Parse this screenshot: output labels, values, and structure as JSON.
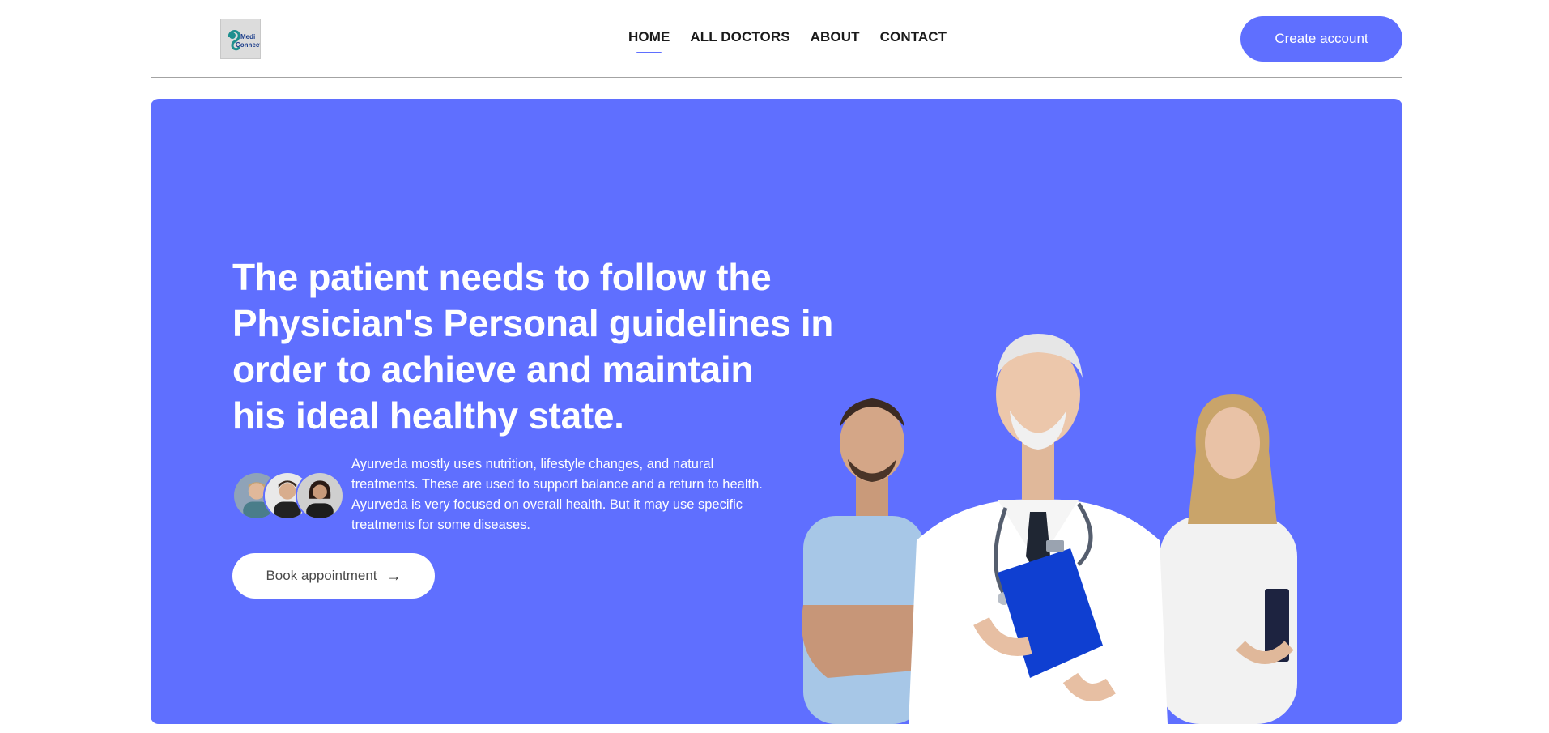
{
  "brand": {
    "logo_text_line1": "Medi",
    "logo_text_line2": "Connect"
  },
  "nav": {
    "items": [
      {
        "label": "HOME",
        "active": true
      },
      {
        "label": "ALL DOCTORS",
        "active": false
      },
      {
        "label": "ABOUT",
        "active": false
      },
      {
        "label": "CONTACT",
        "active": false
      }
    ],
    "cta_label": "Create account"
  },
  "hero": {
    "headline_lines": [
      "The patient needs to follow the",
      "Physician's Personal guidelines in",
      "order to achieve and maintain",
      "his ideal healthy state."
    ],
    "description": "Ayurveda mostly uses nutrition, lifestyle changes, and natural treatments. These are used to support balance and a return to health. Ayurveda is very focused on overall health. But it may use specific treatments for some diseases.",
    "book_label": "Book appointment",
    "book_icon": "arrow-right-icon"
  },
  "colors": {
    "primary": "#5f6fff",
    "white": "#ffffff",
    "text_dark": "#1a1a1a"
  }
}
